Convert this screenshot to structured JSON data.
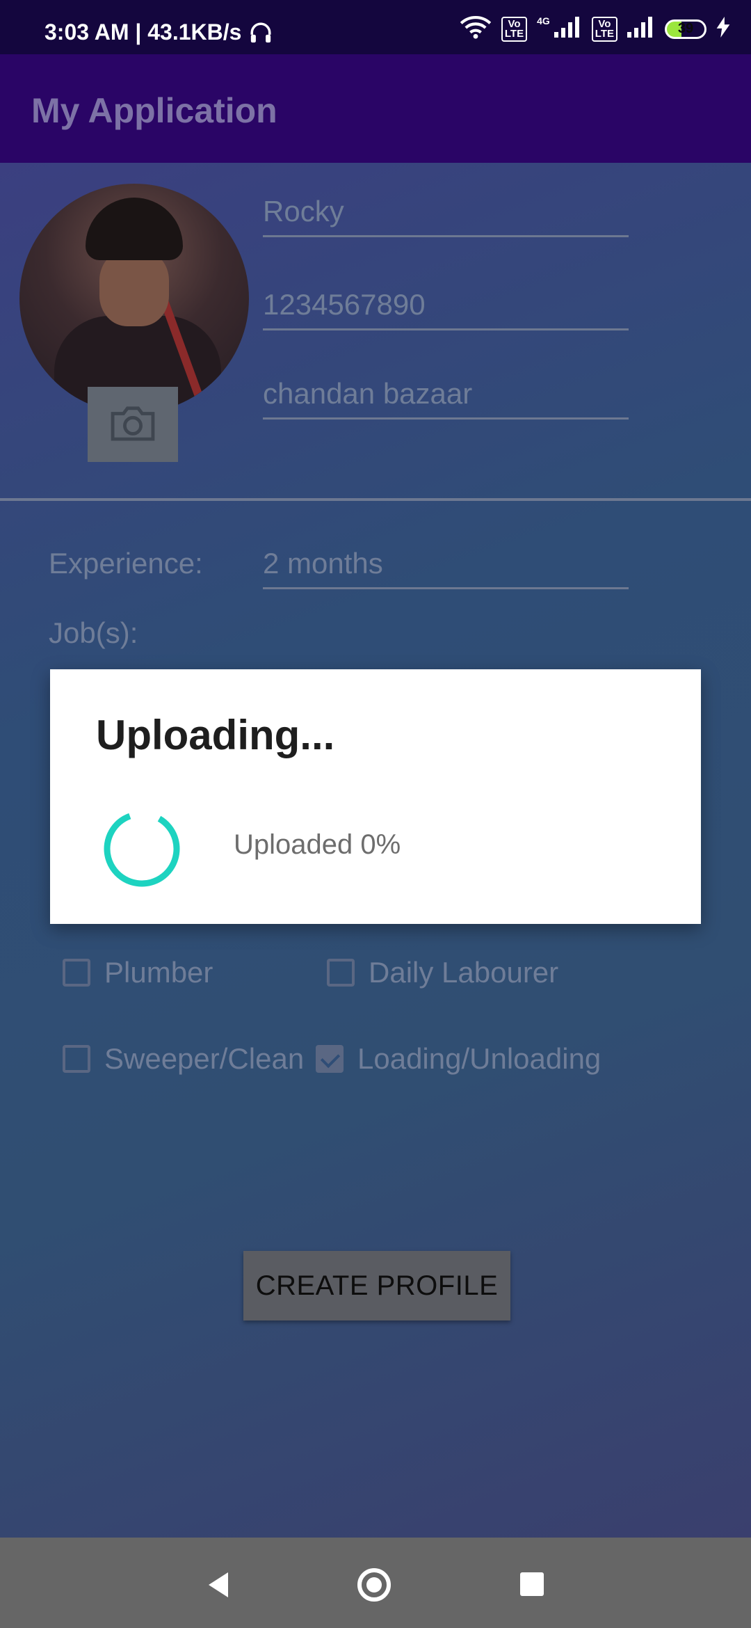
{
  "status_bar": {
    "time": "3:03 AM | 43.1KB/s",
    "volte1": "Vo\nLTE",
    "network": "4G",
    "volte2": "Vo\nLTE",
    "battery": "39"
  },
  "app_bar": {
    "title": "My Application"
  },
  "profile": {
    "name_value": "Rocky",
    "phone_value": "1234567890",
    "address_value": "chandan bazaar",
    "experience_label": "Experience:",
    "experience_value": "2 months",
    "jobs_label": "Job(s):"
  },
  "jobs": [
    {
      "label": "Plumber",
      "checked": false
    },
    {
      "label": "Daily Labourer",
      "checked": false
    },
    {
      "label": "Sweeper/Clean",
      "checked": false
    },
    {
      "label": "Loading/Unloading",
      "checked": true
    }
  ],
  "create_button": {
    "label": "CREATE PROFILE"
  },
  "dialog": {
    "title": "Uploading...",
    "message": "Uploaded 0%",
    "progress_percent": 0,
    "spinner_color": "#1dd3c0"
  },
  "colors": {
    "status_bar_bg": "#14063e",
    "app_bar_bg": "#2a0566"
  },
  "icons": {
    "camera": "camera-icon",
    "wifi": "wifi-icon",
    "headphones": "headphones-icon",
    "charging": "charging-bolt-icon"
  }
}
